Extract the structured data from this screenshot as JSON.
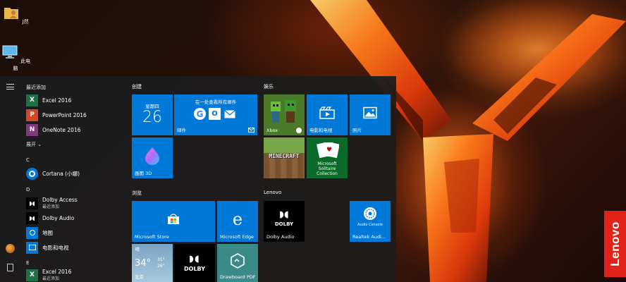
{
  "desktop": {
    "icons": [
      {
        "label": "J然",
        "icon": "user-folder-icon"
      },
      {
        "label": "此电脑",
        "icon": "computer-icon"
      }
    ],
    "brand_badge": "Lenovo"
  },
  "start_menu": {
    "app_list": {
      "recent_header": "最近添加",
      "recent": [
        {
          "label": "Excel 2016",
          "icon_letter": "X",
          "color": "#1e7145"
        },
        {
          "label": "PowerPoint 2016",
          "icon_letter": "P",
          "color": "#d24726"
        },
        {
          "label": "OneNote 2016",
          "icon_letter": "N",
          "color": "#80397b"
        }
      ],
      "expand_label": "展开 ⌄",
      "sections": [
        {
          "letter": "C",
          "items": [
            {
              "label": "Cortana (小娜)"
            }
          ]
        },
        {
          "letter": "D",
          "items": [
            {
              "label": "Dolby Access",
              "sub": "最近添加"
            },
            {
              "label": "Dolby Audio"
            },
            {
              "label": "地图"
            },
            {
              "label": "电影和电视"
            }
          ]
        },
        {
          "letter": "E",
          "items": [
            {
              "label": "Excel 2016",
              "sub": "最近添加"
            }
          ]
        }
      ]
    },
    "tile_groups": {
      "create": {
        "title": "创建",
        "calendar": {
          "weekday": "星期四",
          "day": "26"
        },
        "mail": {
          "header": "在一处查看所有邮件",
          "label": "邮件"
        },
        "paint3d": {
          "label": "画图 3D"
        }
      },
      "play": {
        "title": "娱乐",
        "xbox": {
          "label": "Xbox"
        },
        "movies": {
          "label": "电影和电视"
        },
        "photos": {
          "label": "照片"
        },
        "minecraft": {
          "text": "MINECRAFT"
        },
        "solitaire": {
          "label": "Microsoft Solitaire Collection"
        }
      },
      "browse": {
        "title": "浏览",
        "store": {
          "label": "Microsoft Store"
        },
        "edge": {
          "label": "Microsoft Edge"
        },
        "weather": {
          "condition": "晴",
          "temp": "34°",
          "high": "35°",
          "low": "26°",
          "city": "北京"
        },
        "dolby": {
          "text": "DOLBY"
        },
        "drawboard": {
          "label": "Drawboard PDF"
        }
      },
      "lenovo": {
        "title": "Lenovo",
        "dolby_audio": {
          "text": "DOLBY",
          "label": "Dolby Audio"
        },
        "realtek": {
          "label": "Realtek Audi...",
          "caption": "Audio Console"
        }
      }
    }
  },
  "colors": {
    "tile_blue": "#0078d7",
    "menu_bg": "#1c1c1c",
    "lenovo_red": "#e2231a"
  }
}
